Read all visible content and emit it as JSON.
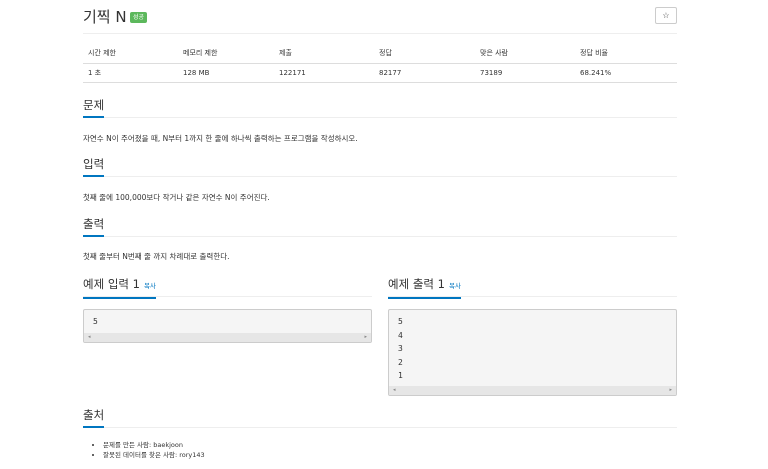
{
  "problem": {
    "title": "기찍 N",
    "badge": "성공",
    "star_icon": "☆"
  },
  "stats": {
    "headers": [
      "시간 제한",
      "메모리 제한",
      "제출",
      "정답",
      "맞은 사람",
      "정답 비율"
    ],
    "values": [
      "1 초",
      "128 MB",
      "122171",
      "82177",
      "73189",
      "68.241%"
    ]
  },
  "sections": {
    "description": {
      "title": "문제",
      "text": "자연수 N이 주어졌을 때, N부터 1까지 한 줄에 하나씩 출력하는 프로그램을 작성하시오."
    },
    "input": {
      "title": "입력",
      "text": "첫째 줄에 100,000보다 작거나 같은 자연수 N이 주어진다."
    },
    "output": {
      "title": "출력",
      "text": "첫째 줄부터 N번째 줄 까지 차례대로 출력한다."
    }
  },
  "samples": {
    "input": {
      "title": "예제 입력 1",
      "copy": "복사",
      "content": "5"
    },
    "output": {
      "title": "예제 출력 1",
      "copy": "복사",
      "content": "5\n4\n3\n2\n1"
    }
  },
  "source": {
    "title": "출처",
    "items": [
      "문제를 만든 사람: baekjoon",
      "잘못된 데이터를 찾은 사람: rory143"
    ]
  },
  "icons": {
    "scroll_left": "◂",
    "scroll_right": "▸"
  },
  "colors": {
    "accent": "#0076c0",
    "badge_success": "#5cb85c"
  }
}
